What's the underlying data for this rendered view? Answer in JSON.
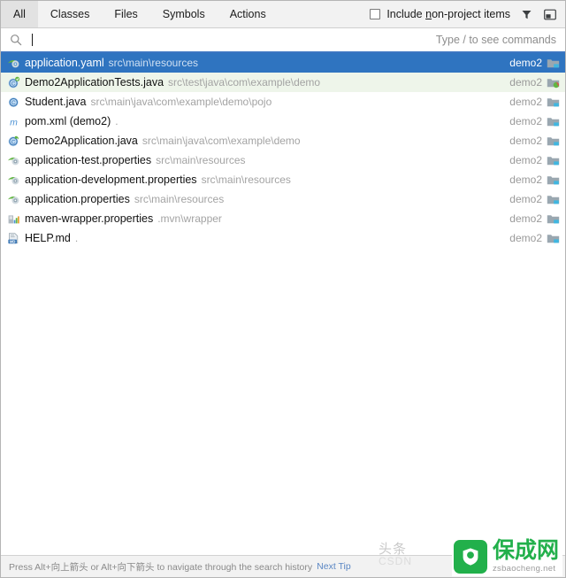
{
  "header": {
    "tabs": [
      {
        "label": "All",
        "selected": true
      },
      {
        "label": "Classes",
        "selected": false
      },
      {
        "label": "Files",
        "selected": false
      },
      {
        "label": "Symbols",
        "selected": false
      },
      {
        "label": "Actions",
        "selected": false
      }
    ],
    "checkbox": {
      "label_before": "Include ",
      "label_underlined": "n",
      "label_after": "on-project items",
      "checked": false
    },
    "filter_icon": "filter-icon",
    "preview_icon": "preview-panel-icon"
  },
  "search": {
    "icon": "search-icon",
    "value": "",
    "placeholder": "",
    "hint": "Type / to see commands"
  },
  "results": [
    {
      "icon": "yaml-file-icon",
      "name": "application.yaml",
      "path": "src\\main\\resources",
      "module": "demo2",
      "module_icon": "module-folder-icon",
      "state": "selected"
    },
    {
      "icon": "java-test-class-icon",
      "name": "Demo2ApplicationTests.java",
      "path": "src\\test\\java\\com\\example\\demo",
      "module": "demo2",
      "module_icon": "module-test-folder-icon",
      "state": "test-source"
    },
    {
      "icon": "java-class-icon",
      "name": "Student.java",
      "path": "src\\main\\java\\com\\example\\demo\\pojo",
      "module": "demo2",
      "module_icon": "module-folder-icon",
      "state": "normal"
    },
    {
      "icon": "maven-pom-icon",
      "name": "pom.xml (demo2)",
      "path": ".",
      "module": "demo2",
      "module_icon": "module-folder-icon",
      "state": "normal"
    },
    {
      "icon": "spring-boot-class-icon",
      "name": "Demo2Application.java",
      "path": "src\\main\\java\\com\\example\\demo",
      "module": "demo2",
      "module_icon": "module-folder-icon",
      "state": "normal"
    },
    {
      "icon": "properties-file-icon",
      "name": "application-test.properties",
      "path": "src\\main\\resources",
      "module": "demo2",
      "module_icon": "module-folder-icon",
      "state": "normal"
    },
    {
      "icon": "properties-file-icon",
      "name": "application-development.properties",
      "path": "src\\main\\resources",
      "module": "demo2",
      "module_icon": "module-folder-icon",
      "state": "normal"
    },
    {
      "icon": "properties-file-icon",
      "name": "application.properties",
      "path": "src\\main\\resources",
      "module": "demo2",
      "module_icon": "module-folder-icon",
      "state": "normal"
    },
    {
      "icon": "maven-wrapper-icon",
      "name": "maven-wrapper.properties",
      "path": ".mvn\\wrapper",
      "module": "demo2",
      "module_icon": "module-folder-icon",
      "state": "normal"
    },
    {
      "icon": "markdown-file-icon",
      "name": "HELP.md",
      "path": ".",
      "module": "demo2",
      "module_icon": "module-folder-icon",
      "state": "normal"
    }
  ],
  "footer": {
    "tip": "Press Alt+向上箭头 or Alt+向下箭头 to navigate through the search history",
    "next_tip_label": "Next Tip"
  },
  "watermarks": {
    "csdn_cn": "头条",
    "csdn_en": "CSDN",
    "badge_cn": "保成网",
    "badge_en": "zsbaocheng.net"
  },
  "colors": {
    "selection_blue": "#2f74c0",
    "test_source_green": "#eef5ea",
    "search_underline": "#3c76c2",
    "badge_green": "#22b04b",
    "path_gray": "#a3a3a3"
  }
}
